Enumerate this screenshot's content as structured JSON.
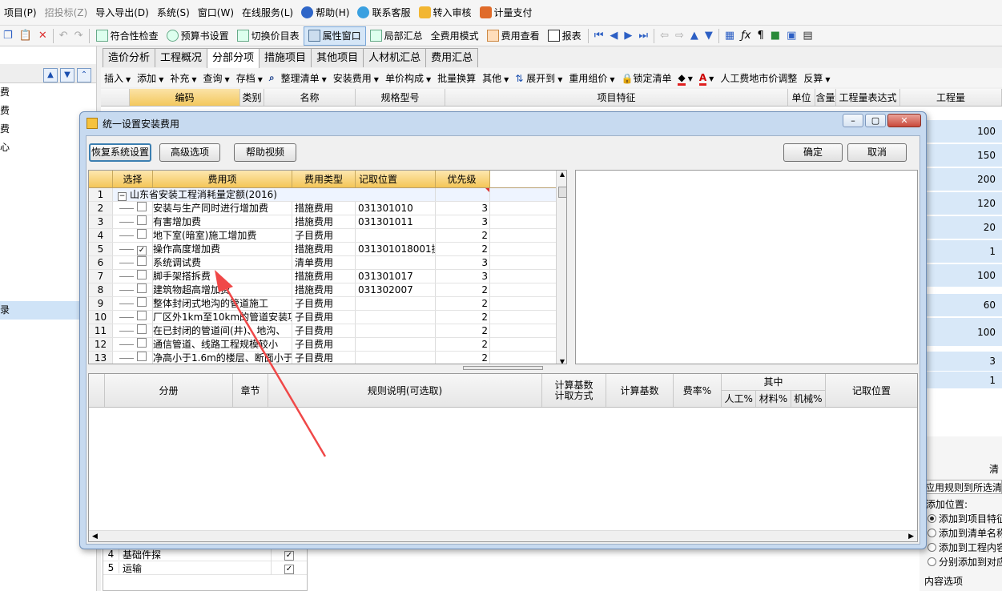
{
  "menubar": {
    "items": [
      {
        "label": "项目(P)",
        "disabled": false
      },
      {
        "label": "招投标(Z)",
        "disabled": true
      },
      {
        "label": "导入导出(D)",
        "disabled": false
      },
      {
        "label": "系统(S)",
        "disabled": false
      },
      {
        "label": "窗口(W)",
        "disabled": false
      },
      {
        "label": "在线服务(L)",
        "disabled": false
      },
      {
        "label": "帮助(H)",
        "disabled": false
      },
      {
        "label": "联系客服",
        "disabled": false
      },
      {
        "label": "转入审核",
        "disabled": false
      },
      {
        "label": "计量支付",
        "disabled": false
      }
    ]
  },
  "toolbar": {
    "buttons": [
      "符合性检查",
      "预算书设置",
      "切换价目表",
      "属性窗口",
      "局部汇总",
      "全费用模式",
      "费用查看",
      "报表"
    ]
  },
  "left_panel": {
    "rows": [
      "费",
      "费",
      "费",
      "心",
      "录"
    ]
  },
  "tabs": [
    "造价分析",
    "工程概况",
    "分部分项",
    "措施项目",
    "其他项目",
    "人材机汇总",
    "费用汇总"
  ],
  "subtoolbar": {
    "items": [
      "插入",
      "添加",
      "补充",
      "查询",
      "存档",
      "整理清单",
      "安装费用",
      "单价构成",
      "批量换算",
      "其他",
      "展开到",
      "重用组价",
      "锁定清单",
      "人工费地市价调整",
      "反算"
    ]
  },
  "main_header": {
    "columns": [
      "编码",
      "类别",
      "名称",
      "规格型号",
      "项目特征",
      "单位",
      "含量",
      "工程量表达式",
      "工程量"
    ]
  },
  "main_quantities": [
    "100",
    "150",
    "200",
    "120",
    "20",
    "1",
    "100",
    "60",
    "100",
    "3",
    "1"
  ],
  "right_panel": {
    "header": "清",
    "apply_text": "应用规则到所选清",
    "add_position_label": "添加位置:",
    "options": [
      {
        "label": "添加到项目特征",
        "selected": true
      },
      {
        "label": "添加到清单名称",
        "selected": false
      },
      {
        "label": "添加到工程内容",
        "selected": false
      },
      {
        "label": "分别添加到对应",
        "selected": false
      }
    ],
    "footer": "内容选项"
  },
  "bottom_left": {
    "rows": [
      {
        "no": "4",
        "name": "基础件探",
        "checked": true
      },
      {
        "no": "5",
        "name": "运输",
        "checked": true
      }
    ]
  },
  "dialog": {
    "title": "统一设置安装费用",
    "buttons": {
      "restore": "恢复系统设置",
      "advanced": "高级选项",
      "help_video": "帮助视频",
      "ok": "确定",
      "cancel": "取消"
    },
    "grid_headers": [
      "选择",
      "费用项",
      "费用类型",
      "记取位置",
      "优先级"
    ],
    "group_row": {
      "no": "1",
      "name": "山东省安装工程消耗量定额(2016)"
    },
    "rows": [
      {
        "no": "2",
        "name": "安装与生产同时进行增加费",
        "type": "措施费用",
        "pos": "031301010",
        "priority": "3",
        "checked": false
      },
      {
        "no": "3",
        "name": "有害增加费",
        "type": "措施费用",
        "pos": "031301011",
        "priority": "3",
        "checked": false
      },
      {
        "no": "4",
        "name": "地下室(暗室)施工增加费",
        "type": "子目费用",
        "pos": "",
        "priority": "2",
        "checked": false
      },
      {
        "no": "5",
        "name": "操作高度增加费",
        "type": "措施费用",
        "pos": "031301018001操",
        "priority": "2",
        "checked": true
      },
      {
        "no": "6",
        "name": "系统调试费",
        "type": "清单费用",
        "pos": "",
        "priority": "3",
        "checked": false
      },
      {
        "no": "7",
        "name": "脚手架搭拆费",
        "type": "措施费用",
        "pos": "031301017",
        "priority": "3",
        "checked": false
      },
      {
        "no": "8",
        "name": "建筑物超高增加费",
        "type": "措施费用",
        "pos": "031302007",
        "priority": "2",
        "checked": false
      },
      {
        "no": "9",
        "name": "整体封闭式地沟的管道施工",
        "type": "子目费用",
        "pos": "",
        "priority": "2",
        "checked": false
      },
      {
        "no": "10",
        "name": "厂区外1km至10km的管道安装项",
        "type": "子目费用",
        "pos": "",
        "priority": "2",
        "checked": false
      },
      {
        "no": "11",
        "name": "在已封闭的管道间(井)、地沟、",
        "type": "子目费用",
        "pos": "",
        "priority": "2",
        "checked": false
      },
      {
        "no": "12",
        "name": "通信管道、线路工程规模较小",
        "type": "子目费用",
        "pos": "",
        "priority": "2",
        "checked": false
      },
      {
        "no": "13",
        "name": "净高小于1.6m的楼层、断面小于",
        "type": "子目费用",
        "pos": "",
        "priority": "2",
        "checked": false
      }
    ],
    "lower_headers": {
      "fence": "分册",
      "chapter": "章节",
      "rule": "规则说明(可选取)",
      "calc_base_method": "计算基数计取方式",
      "calc_base": "计算基数",
      "rate": "费率%",
      "of_which": "其中",
      "labor": "人工%",
      "material": "材料%",
      "machine": "机械%",
      "record_pos": "记取位置"
    }
  }
}
